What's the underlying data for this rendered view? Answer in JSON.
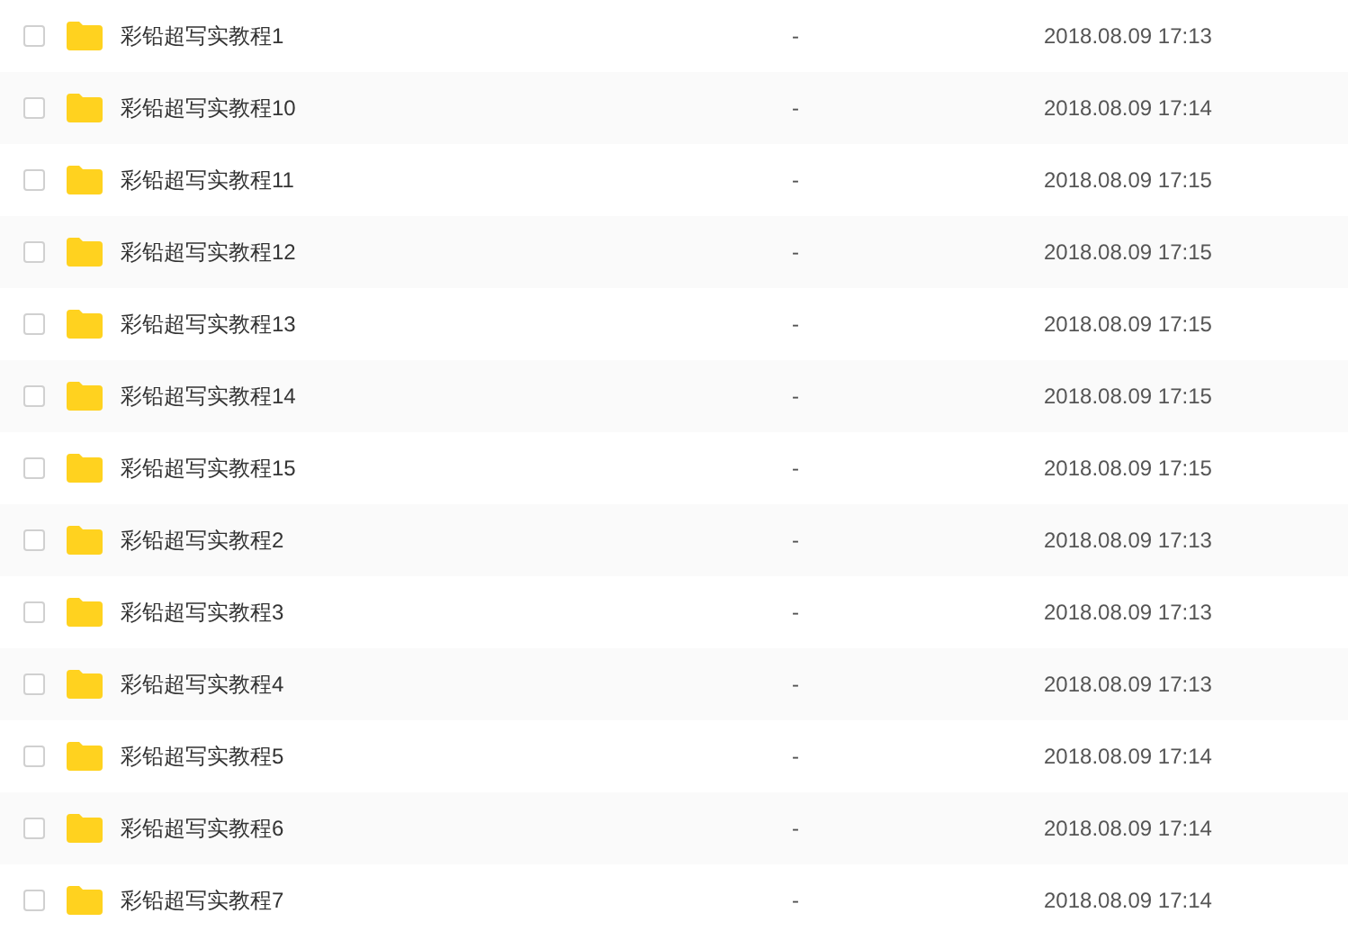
{
  "files": [
    {
      "name": "彩铅超写实教程1",
      "size": "-",
      "modified": "2018.08.09 17:13",
      "checked": false
    },
    {
      "name": "彩铅超写实教程10",
      "size": "-",
      "modified": "2018.08.09 17:14",
      "checked": false
    },
    {
      "name": "彩铅超写实教程11",
      "size": "-",
      "modified": "2018.08.09 17:15",
      "checked": false
    },
    {
      "name": "彩铅超写实教程12",
      "size": "-",
      "modified": "2018.08.09 17:15",
      "checked": false
    },
    {
      "name": "彩铅超写实教程13",
      "size": "-",
      "modified": "2018.08.09 17:15",
      "checked": false
    },
    {
      "name": "彩铅超写实教程14",
      "size": "-",
      "modified": "2018.08.09 17:15",
      "checked": false
    },
    {
      "name": "彩铅超写实教程15",
      "size": "-",
      "modified": "2018.08.09 17:15",
      "checked": false
    },
    {
      "name": "彩铅超写实教程2",
      "size": "-",
      "modified": "2018.08.09 17:13",
      "checked": false
    },
    {
      "name": "彩铅超写实教程3",
      "size": "-",
      "modified": "2018.08.09 17:13",
      "checked": false
    },
    {
      "name": "彩铅超写实教程4",
      "size": "-",
      "modified": "2018.08.09 17:13",
      "checked": false
    },
    {
      "name": "彩铅超写实教程5",
      "size": "-",
      "modified": "2018.08.09 17:14",
      "checked": false
    },
    {
      "name": "彩铅超写实教程6",
      "size": "-",
      "modified": "2018.08.09 17:14",
      "checked": false
    },
    {
      "name": "彩铅超写实教程7",
      "size": "-",
      "modified": "2018.08.09 17:14",
      "checked": false
    }
  ]
}
